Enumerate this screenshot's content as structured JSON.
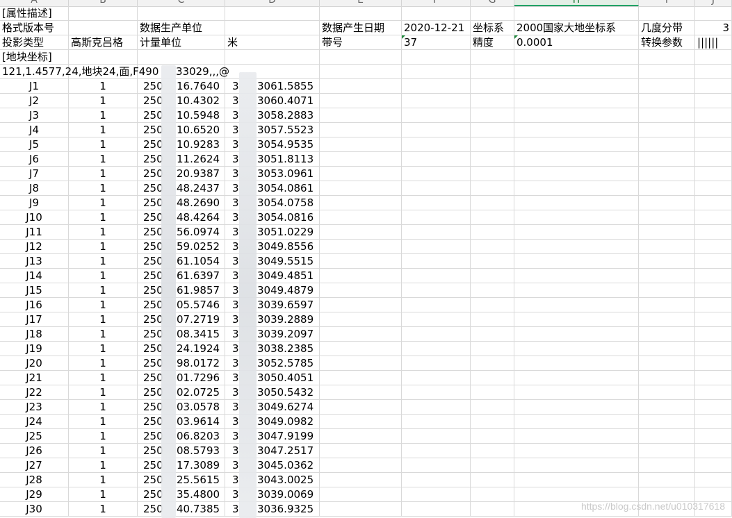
{
  "column_headers": [
    "A",
    "B",
    "C",
    "D",
    "E",
    "F",
    "G",
    "H",
    "I",
    "J"
  ],
  "selected_column": "H",
  "meta_rows": {
    "row1": {
      "a": "[属性描述]"
    },
    "row2": {
      "a": "格式版本号",
      "c": "数据生产单位",
      "e": "数据产生日期",
      "f": "2020-12-21",
      "g": "坐标系",
      "h": "2000国家大地坐标系",
      "i": "几度分带",
      "j": "3"
    },
    "row3": {
      "a": "投影类型",
      "b": "高斯克吕格",
      "c": "计量单位",
      "d": "米",
      "e": "带号",
      "f": "37",
      "g": "精度",
      "h": "0.0001",
      "i": "转换参数",
      "j": "||||||"
    },
    "row4": {
      "a": "[地块坐标]"
    },
    "row5": {
      "a": "121,1.4577,24,地块24,面,F490",
      "a_tail": "33029,,,@"
    }
  },
  "points": [
    {
      "id": "J1",
      "ring": "1",
      "x_prefix": "250",
      "x_suffix": "16.7640",
      "y_prefix": "3",
      "y_suffix": "3061.5855"
    },
    {
      "id": "J2",
      "ring": "1",
      "x_prefix": "250",
      "x_suffix": "10.4302",
      "y_prefix": "3",
      "y_suffix": "3060.4071"
    },
    {
      "id": "J3",
      "ring": "1",
      "x_prefix": "250",
      "x_suffix": "10.5948",
      "y_prefix": "3",
      "y_suffix": "3058.2883"
    },
    {
      "id": "J4",
      "ring": "1",
      "x_prefix": "250",
      "x_suffix": "10.6520",
      "y_prefix": "3",
      "y_suffix": "3057.5523"
    },
    {
      "id": "J5",
      "ring": "1",
      "x_prefix": "250",
      "x_suffix": "10.9283",
      "y_prefix": "3",
      "y_suffix": "3054.9535"
    },
    {
      "id": "J6",
      "ring": "1",
      "x_prefix": "250",
      "x_suffix": "11.2624",
      "y_prefix": "3",
      "y_suffix": "3051.8113"
    },
    {
      "id": "J7",
      "ring": "1",
      "x_prefix": "250",
      "x_suffix": "20.9387",
      "y_prefix": "3",
      "y_suffix": "3053.0961"
    },
    {
      "id": "J8",
      "ring": "1",
      "x_prefix": "250",
      "x_suffix": "48.2437",
      "y_prefix": "3",
      "y_suffix": "3054.0861"
    },
    {
      "id": "J9",
      "ring": "1",
      "x_prefix": "250",
      "x_suffix": "48.2690",
      "y_prefix": "3",
      "y_suffix": "3054.0758"
    },
    {
      "id": "J10",
      "ring": "1",
      "x_prefix": "250",
      "x_suffix": "48.4264",
      "y_prefix": "3",
      "y_suffix": "3054.0816"
    },
    {
      "id": "J11",
      "ring": "1",
      "x_prefix": "250",
      "x_suffix": "56.0974",
      "y_prefix": "3",
      "y_suffix": "3051.0229"
    },
    {
      "id": "J12",
      "ring": "1",
      "x_prefix": "250",
      "x_suffix": "59.0252",
      "y_prefix": "3",
      "y_suffix": "3049.8556"
    },
    {
      "id": "J13",
      "ring": "1",
      "x_prefix": "250",
      "x_suffix": "61.1054",
      "y_prefix": "3",
      "y_suffix": "3049.5515"
    },
    {
      "id": "J14",
      "ring": "1",
      "x_prefix": "250",
      "x_suffix": "61.6397",
      "y_prefix": "3",
      "y_suffix": "3049.4851"
    },
    {
      "id": "J15",
      "ring": "1",
      "x_prefix": "250",
      "x_suffix": "61.9857",
      "y_prefix": "3",
      "y_suffix": "3049.4879"
    },
    {
      "id": "J16",
      "ring": "1",
      "x_prefix": "250",
      "x_suffix": "05.5746",
      "y_prefix": "3",
      "y_suffix": "3039.6597"
    },
    {
      "id": "J17",
      "ring": "1",
      "x_prefix": "250",
      "x_suffix": "07.2719",
      "y_prefix": "3",
      "y_suffix": "3039.2889"
    },
    {
      "id": "J18",
      "ring": "1",
      "x_prefix": "250",
      "x_suffix": "08.3415",
      "y_prefix": "3",
      "y_suffix": "3039.2097"
    },
    {
      "id": "J19",
      "ring": "1",
      "x_prefix": "250",
      "x_suffix": "24.1924",
      "y_prefix": "3",
      "y_suffix": "3038.2385"
    },
    {
      "id": "J20",
      "ring": "1",
      "x_prefix": "250",
      "x_suffix": "98.0172",
      "y_prefix": "3",
      "y_suffix": "3052.5785"
    },
    {
      "id": "J21",
      "ring": "1",
      "x_prefix": "250",
      "x_suffix": "01.7296",
      "y_prefix": "3",
      "y_suffix": "3050.4051"
    },
    {
      "id": "J22",
      "ring": "1",
      "x_prefix": "250",
      "x_suffix": "02.0725",
      "y_prefix": "3",
      "y_suffix": "3050.5432"
    },
    {
      "id": "J23",
      "ring": "1",
      "x_prefix": "250",
      "x_suffix": "03.0578",
      "y_prefix": "3",
      "y_suffix": "3049.6274"
    },
    {
      "id": "J24",
      "ring": "1",
      "x_prefix": "250",
      "x_suffix": "03.9614",
      "y_prefix": "3",
      "y_suffix": "3049.0982"
    },
    {
      "id": "J25",
      "ring": "1",
      "x_prefix": "250",
      "x_suffix": "06.8203",
      "y_prefix": "3",
      "y_suffix": "3047.9199"
    },
    {
      "id": "J26",
      "ring": "1",
      "x_prefix": "250",
      "x_suffix": "08.5793",
      "y_prefix": "3",
      "y_suffix": "3047.2517"
    },
    {
      "id": "J27",
      "ring": "1",
      "x_prefix": "250",
      "x_suffix": "17.3089",
      "y_prefix": "3",
      "y_suffix": "3045.0362"
    },
    {
      "id": "J28",
      "ring": "1",
      "x_prefix": "250",
      "x_suffix": "25.5615",
      "y_prefix": "3",
      "y_suffix": "3043.0025"
    },
    {
      "id": "J29",
      "ring": "1",
      "x_prefix": "250",
      "x_suffix": "35.4800",
      "y_prefix": "3",
      "y_suffix": "3039.0069"
    },
    {
      "id": "J30",
      "ring": "1",
      "x_prefix": "250",
      "x_suffix": "40.7385",
      "y_prefix": "3",
      "y_suffix": "3036.9325"
    }
  ],
  "watermark": "https://blog.csdn.net/u010317618",
  "colors": {
    "grid": "#d9d9d9",
    "header_bg": "#f2f2f2",
    "selected_col": "#21a366",
    "comment_marker": "#1e8a3c"
  }
}
